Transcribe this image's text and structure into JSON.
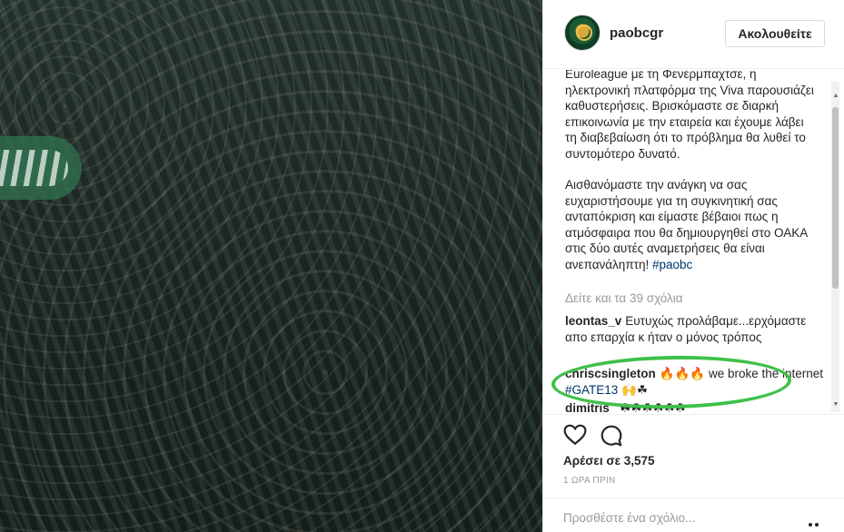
{
  "post": {
    "photo_alt": "",
    "account": {
      "username": "paobcgr",
      "follow_label": "Ακολουθείτε"
    },
    "caption": {
      "paragraph1": "Euroleague με τη Φενέρμπαχτσε, η ηλεκτρονική πλατφόρμα της Viva παρουσιάζει καθυστερήσεις. Βρισκόμαστε σε διαρκή επικοινωνία με την εταιρεία και έχουμε λάβει τη διαβεβαίωση ότι το πρόβλημα θα λυθεί το συντομότερο δυνατό.",
      "paragraph2": "Αισθανόμαστε την ανάγκη να σας ευχαριστήσουμε για τη συγκινητική σας ανταπόκριση και είμαστε βέβαιοι πως η ατμόσφαιρα που θα δημιουργηθεί στο ΟΑΚΑ στις δύο αυτές αναμετρήσεις θα είναι ανεπανάληπτη!",
      "hashtag": "#paobc"
    },
    "view_all_comments": "Δείτε και τα 39 σχόλια",
    "comments": [
      {
        "user": "leontas_v",
        "text": "Ευτυχώς προλάβαμε...ερχόμαστε απο επαρχία κ ήταν ο μόνος τρόπος"
      },
      {
        "user": "chriscsingleton",
        "text_before": "🔥🔥🔥 we broke the internet",
        "hashtag": "#GATE13",
        "text_after": "🙌☘"
      },
      {
        "user": "dimitris_",
        "text": "☘☘☘☘☘☘"
      }
    ],
    "likes": "Αρέσει σε 3,575",
    "timestamp": "1 ΩΡΑ ΠΡΙΝ",
    "comment_placeholder": "Προσθέστε ένα σχόλιο...",
    "icons": {
      "like": "heart-icon",
      "comment": "comment-icon",
      "more": "more-options-icon"
    },
    "colors": {
      "highlight": "#3fc04a",
      "hashtag": "#003569"
    }
  }
}
